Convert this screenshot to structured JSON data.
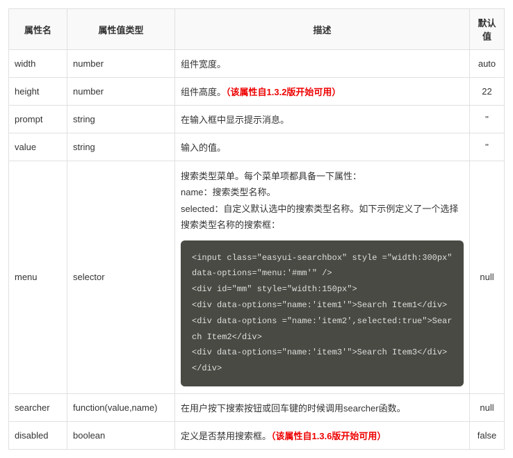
{
  "headers": {
    "name": "属性名",
    "type": "属性值类型",
    "desc": "描述",
    "def": "默认值"
  },
  "rows": [
    {
      "name": "width",
      "type": "number",
      "desc": "组件宽度。",
      "note": "",
      "def": "auto"
    },
    {
      "name": "height",
      "type": "number",
      "desc": "组件高度。",
      "note": "（该属性自1.3.2版开始可用）",
      "def": "22"
    },
    {
      "name": "prompt",
      "type": "string",
      "desc": "在输入框中显示提示消息。",
      "note": "",
      "def": "''"
    },
    {
      "name": "value",
      "type": "string",
      "desc": "输入的值。",
      "note": "",
      "def": "''"
    },
    {
      "name": "menu",
      "type": "selector",
      "desc_lines": [
        "搜索类型菜单。每个菜单项都具备一下属性：",
        "name：搜索类型名称。",
        "selected：自定义默认选中的搜索类型名称。如下示例定义了一个选择搜索类型名称的搜索框："
      ],
      "code": "<input class=\"easyui-searchbox\" style =\"width:300px\" data-options=\"menu:'#mm'\" />\n<div id=\"mm\" style=\"width:150px\">\n<div data-options=\"name:'item1'\">Search Item1</div>\n<div data-options =\"name:'item2',selected:true\">Search Item2</div>\n<div data-options=\"name:'item3'\">Search Item3</div>\n</div>",
      "def": "null"
    },
    {
      "name": "searcher",
      "type": "function(value,name)",
      "desc": "在用户按下搜索按钮或回车键的时候调用searcher函数。",
      "note": "",
      "def": "null"
    },
    {
      "name": "disabled",
      "type": "boolean",
      "desc": "定义是否禁用搜索框。",
      "note": "（该属性自1.3.6版开始可用）",
      "def": "false"
    }
  ]
}
